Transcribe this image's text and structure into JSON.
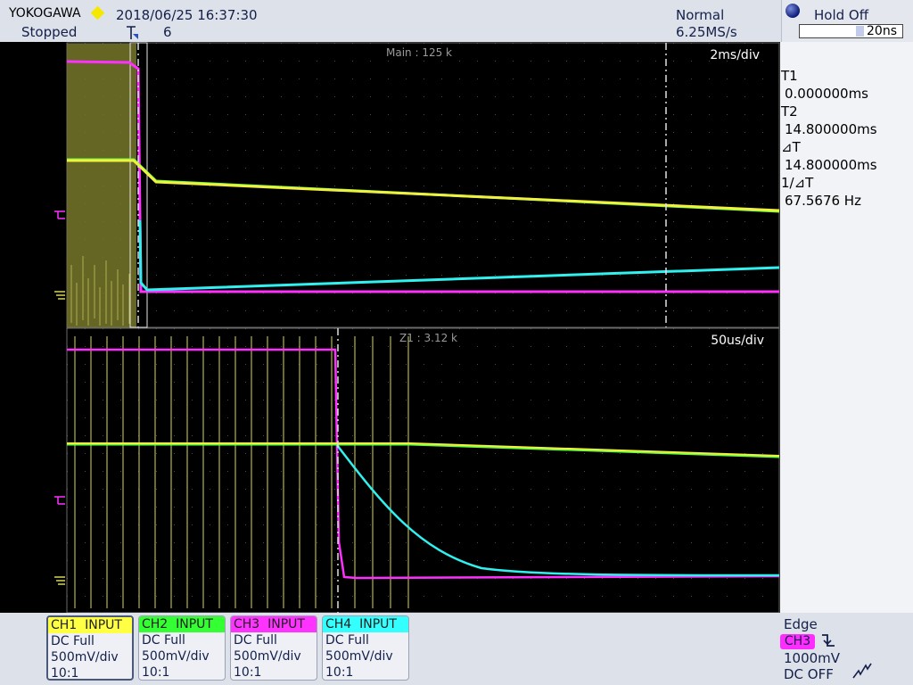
{
  "header": {
    "brand": "YOKOGAWA",
    "datetime": "2018/06/25 16:37:30",
    "run_state": "Stopped",
    "acq_count": "6",
    "acq_mode": "Normal",
    "sample_rate": "6.25MS/s",
    "holdoff_label": "Hold Off",
    "holdoff_value": "20ns"
  },
  "main_window": {
    "label": "Main : 125 k",
    "timebase": "2ms/div"
  },
  "zoom_window": {
    "label": "Z1 : 3.12 k",
    "timebase": "50us/div"
  },
  "cursors": {
    "t1_label": "T1",
    "t1_value": "0.000000ms",
    "t2_label": "T2",
    "t2_value": "14.800000ms",
    "dt_label": "⊿T",
    "dt_value": "14.800000ms",
    "inv_dt_label": "1/⊿T",
    "inv_dt_value": "67.5676 Hz"
  },
  "channels": [
    {
      "name": "CH1",
      "mode": "INPUT",
      "coupling": "DC Full",
      "vdiv": "500mV/div",
      "probe": "10:1",
      "color": "#ffff44"
    },
    {
      "name": "CH2",
      "mode": "INPUT",
      "coupling": "DC Full",
      "vdiv": "500mV/div",
      "probe": "10:1",
      "color": "#33ff33"
    },
    {
      "name": "CH3",
      "mode": "INPUT",
      "coupling": "DC Full",
      "vdiv": "500mV/div",
      "probe": "10:1",
      "color": "#ff33ff"
    },
    {
      "name": "CH4",
      "mode": "INPUT",
      "coupling": "DC Full",
      "vdiv": "500mV/div",
      "probe": "10:1",
      "color": "#33ffff"
    }
  ],
  "trigger": {
    "type": "Edge",
    "source": "CH3",
    "level": "1000mV",
    "coupling": "DC OFF"
  },
  "colors": {
    "ch1": "#f0f040",
    "ch2": "#40ff40",
    "ch3": "#ff30ff",
    "ch4": "#30f0f0",
    "screen_bg": "#000000"
  }
}
